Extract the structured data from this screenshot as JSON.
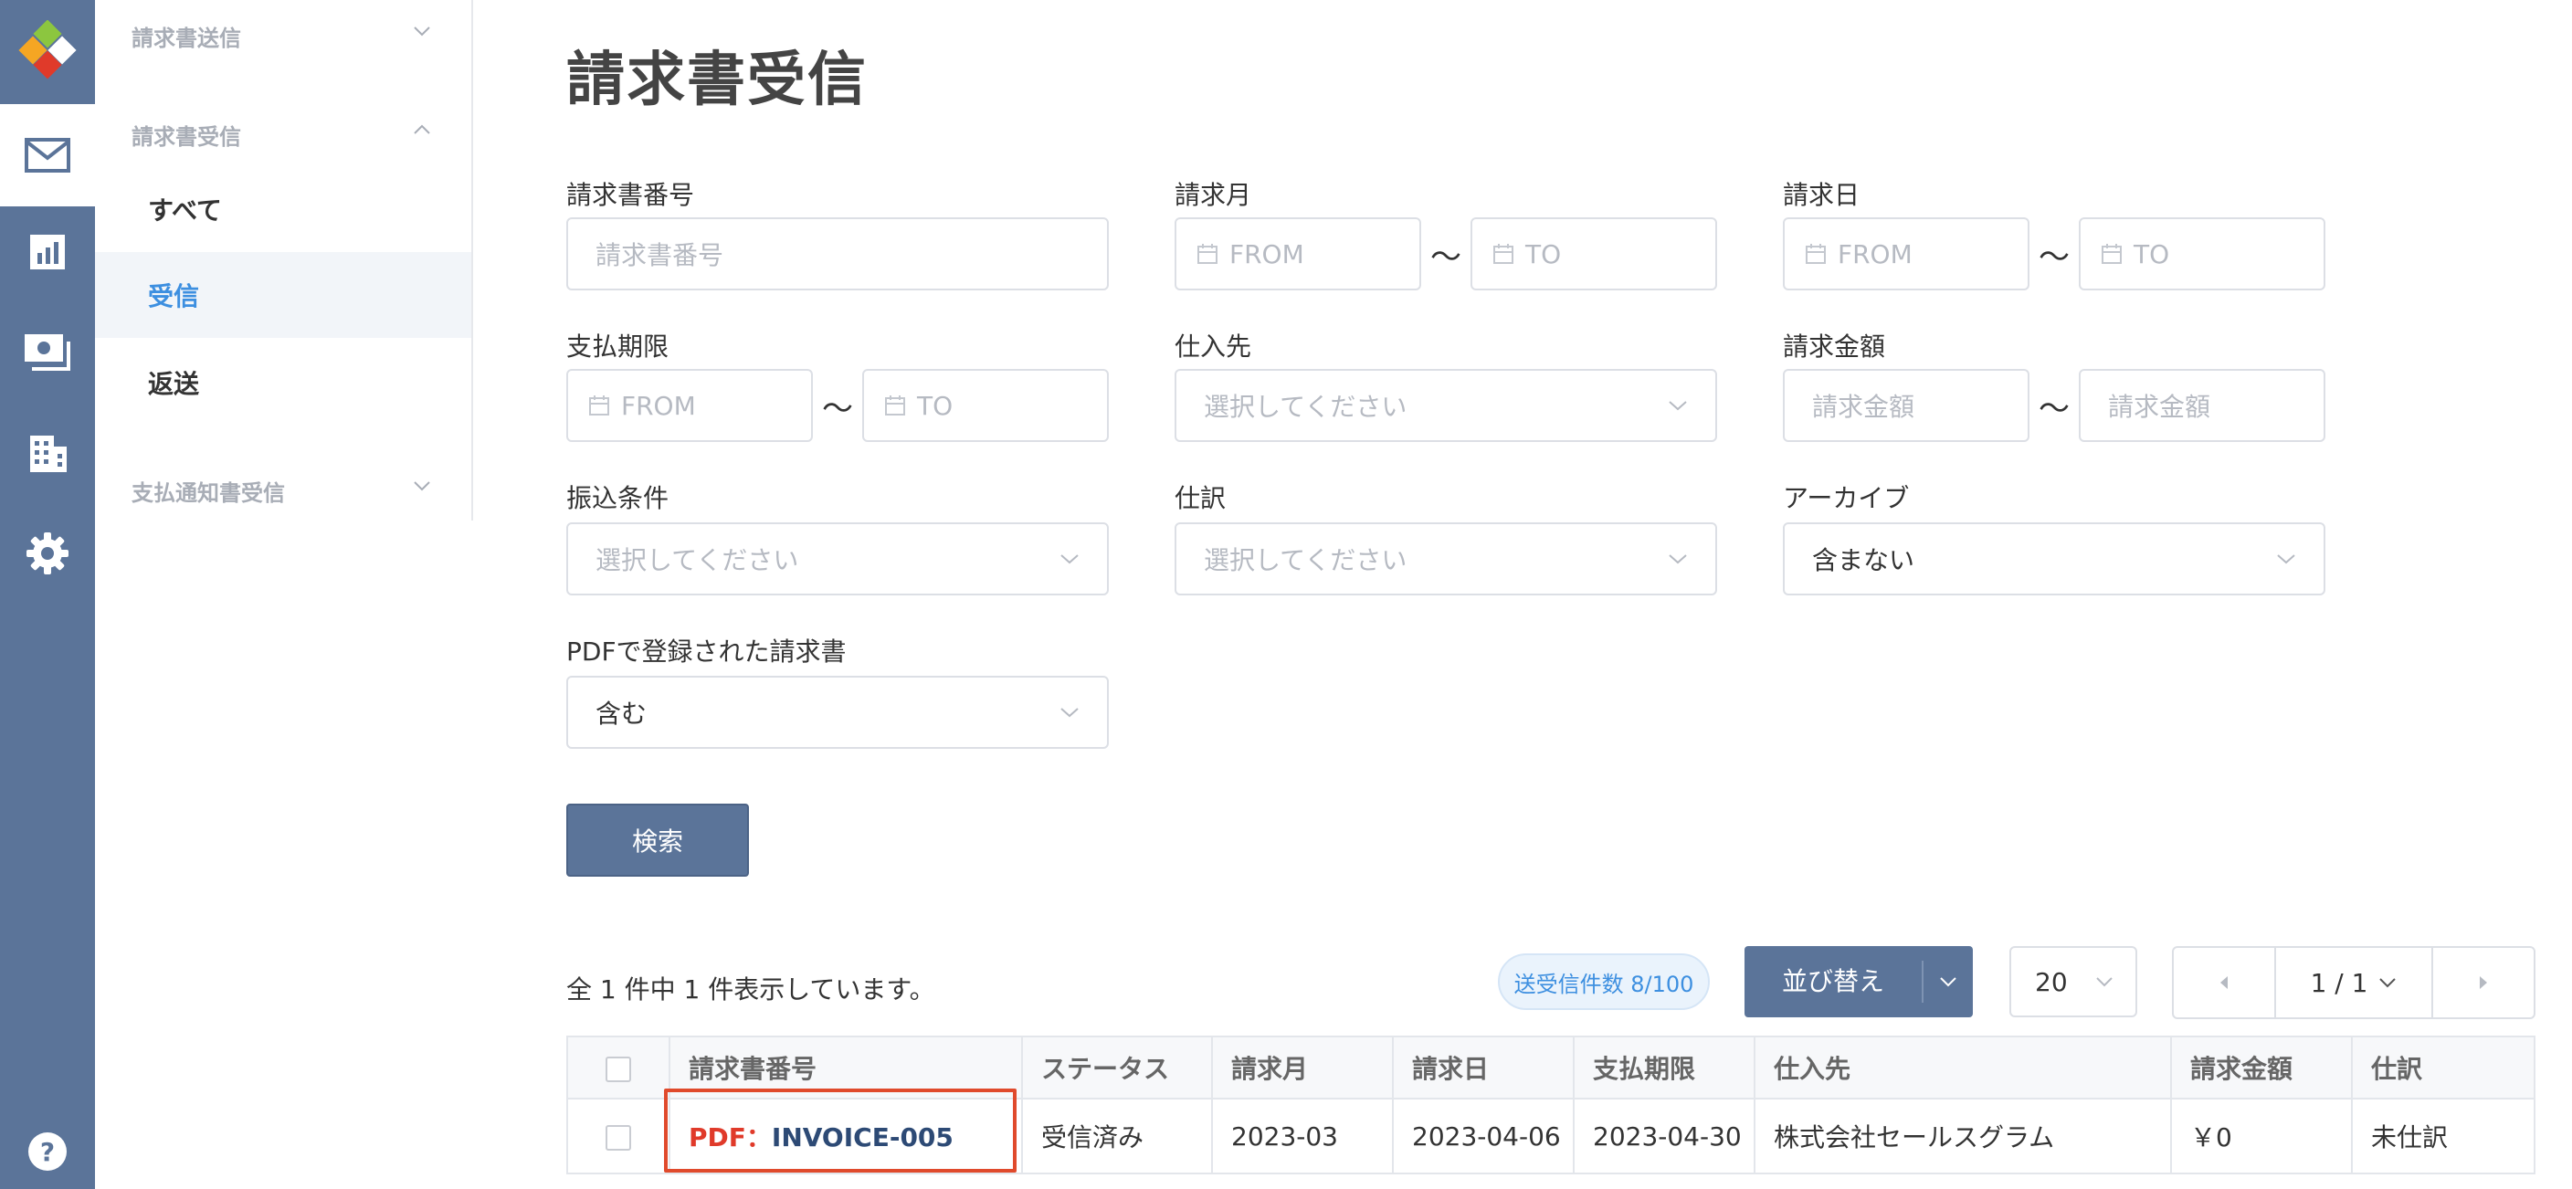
{
  "sidebar": {
    "groups": [
      {
        "label": "請求書送信"
      },
      {
        "label": "請求書受信"
      },
      {
        "label": "支払通知書受信"
      }
    ],
    "items": [
      {
        "label": "すべて"
      },
      {
        "label": "受信"
      },
      {
        "label": "返送"
      }
    ]
  },
  "page": {
    "title": "請求書受信"
  },
  "filters": {
    "invoice_number": {
      "label": "請求書番号",
      "placeholder": "請求書番号"
    },
    "billing_month": {
      "label": "請求月",
      "from": "FROM",
      "to": "TO"
    },
    "billing_date": {
      "label": "請求日",
      "from": "FROM",
      "to": "TO"
    },
    "due_date": {
      "label": "支払期限",
      "from": "FROM",
      "to": "TO"
    },
    "supplier": {
      "label": "仕入先",
      "placeholder": "選択してください"
    },
    "amount": {
      "label": "請求金額",
      "from": "請求金額",
      "to": "請求金額"
    },
    "transfer": {
      "label": "振込条件",
      "placeholder": "選択してください"
    },
    "journal": {
      "label": "仕訳",
      "placeholder": "選択してください"
    },
    "archive": {
      "label": "アーカイブ",
      "value": "含まない"
    },
    "pdf": {
      "label": "PDFで登録された請求書",
      "value": "含む"
    },
    "tilde": "〜",
    "search_label": "検索"
  },
  "results": {
    "count_text": "全 1 件中 1 件表示しています。",
    "badge": "送受信件数 8/100",
    "sort_label": "並び替え",
    "per_page": "20",
    "pagination": "1 / 1"
  },
  "table": {
    "headers": [
      "請求書番号",
      "ステータス",
      "請求月",
      "請求日",
      "支払期限",
      "仕入先",
      "請求金額",
      "仕訳"
    ],
    "rows": [
      {
        "pdf_prefix": "PDF：",
        "invoice": "INVOICE-005",
        "status": "受信済み",
        "month": "2023-03",
        "date": "2023-04-06",
        "due": "2023-04-30",
        "supplier": "株式会社セールスグラム",
        "amount": "￥0",
        "journal": "未仕訳"
      }
    ]
  },
  "colors": {
    "rail": "#5b7499",
    "accent": "#3d8fe0",
    "highlight": "#e04a2c",
    "pdf": "#e03a2a"
  }
}
